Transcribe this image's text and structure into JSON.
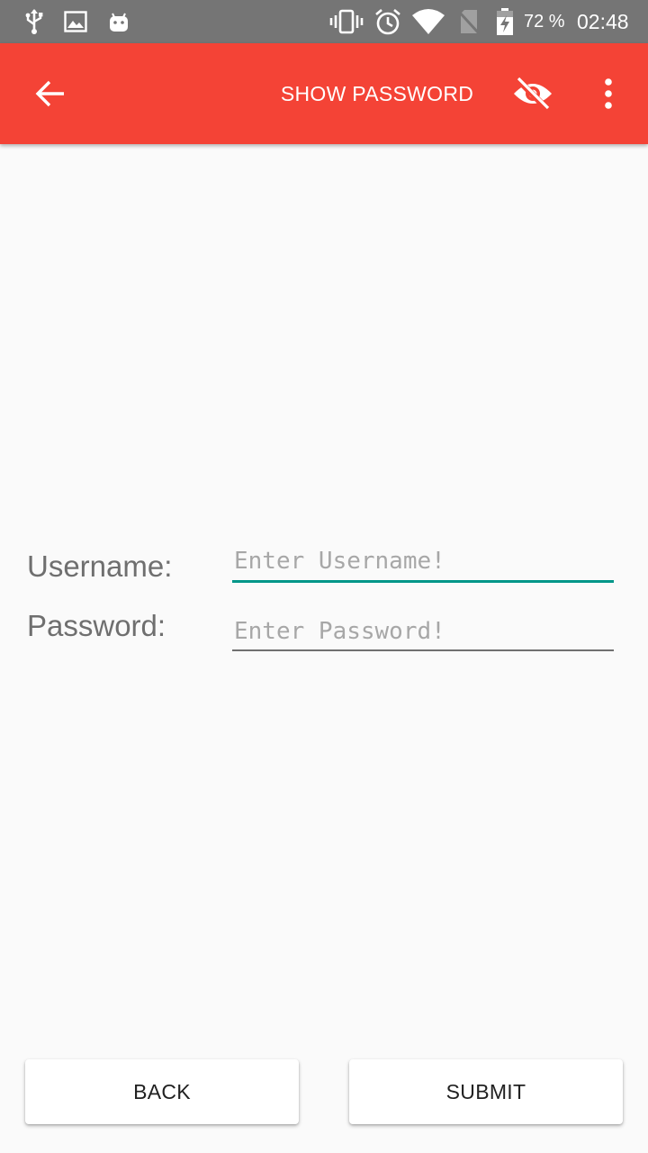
{
  "status_bar": {
    "icons_left": [
      "usb-icon",
      "image-icon",
      "android-icon"
    ],
    "icons_right": [
      "vibrate-icon",
      "alarm-icon",
      "wifi-icon",
      "no-sim-icon",
      "battery-charging-icon"
    ],
    "battery": "72 %",
    "time": "02:48",
    "background": "#757575"
  },
  "app_bar": {
    "back_icon": "arrow-back-icon",
    "action_label": "SHOW PASSWORD",
    "visibility_icon": "visibility-off-icon",
    "overflow_icon": "more-vert-icon",
    "color": "#f44336"
  },
  "form": {
    "username_label": "Username:",
    "username_placeholder": "Enter Username!",
    "username_value": "",
    "password_label": "Password:",
    "password_placeholder": "Enter Password!",
    "password_value": "",
    "focused_underline_color": "#009688"
  },
  "buttons": {
    "back_label": "BACK",
    "submit_label": "SUBMIT"
  }
}
